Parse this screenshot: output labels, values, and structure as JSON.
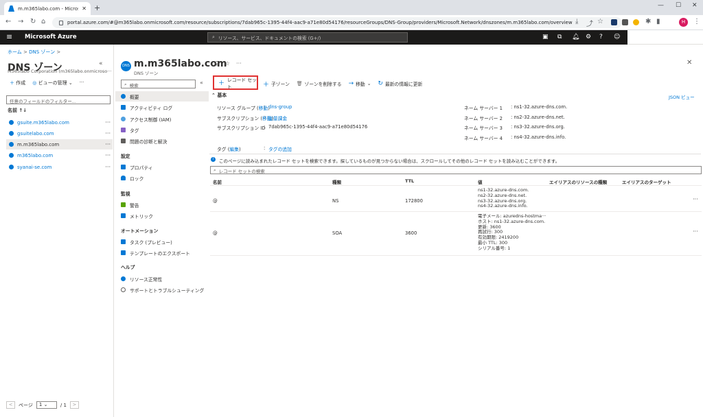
{
  "browser": {
    "tab_title": "m.m365labo.com - Microsoft Az",
    "url": "portal.azure.com/#@m365labo.onmicrosoft.com/resource/subscriptions/7dab965c-1395-44f4-aac9-a71e80d54176/resourceGroups/DNS-Group/providers/Microsoft.Network/dnszones/m.m365labo.com/overview",
    "profile_initial": "H"
  },
  "azure": {
    "brand": "Microsoft Azure",
    "search_placeholder": "リソース、サービス、ドキュメントの検索 (G+/)"
  },
  "breadcrumb": {
    "home": "ホーム",
    "sep1": ">",
    "zones": "DNS ゾーン",
    "sep2": ">"
  },
  "left_blade": {
    "title": "DNS ゾーン",
    "subtitle": "M365labo Corporation (m365labo.onmicroso···",
    "create": "作成",
    "manage_view": "ビューの管理",
    "filter_placeholder": "任意のフィールドのフィルター...",
    "name_header": "名前 ↑↓",
    "zones": [
      "gsuite.m365labo.com",
      "gsuitelabo.com",
      "m.m365labo.com",
      "m365labo.com",
      "syanai-se.com"
    ],
    "pager_label": "ページ",
    "pager_value": "1",
    "pager_total": "/ 1"
  },
  "resource": {
    "icon_label": "DNS",
    "title": "m.m365labo.com",
    "subtitle": "DNS ゾーン"
  },
  "menu": {
    "search_placeholder": "検索",
    "items": {
      "overview": "概要",
      "activity_log": "アクティビティ ログ",
      "iam": "アクセス制御 (IAM)",
      "tags": "タグ",
      "diagnose": "問題の診断と解決"
    },
    "section_settings": "設定",
    "properties": "プロパティ",
    "locks": "ロック",
    "section_monitoring": "監視",
    "alerts": "警告",
    "metrics": "メトリック",
    "section_automation": "オートメーション",
    "tasks": "タスク (プレビュー)",
    "export_template": "テンプレートのエクスポート",
    "section_help": "ヘルプ",
    "resource_health": "リソース正常性",
    "support": "サポートとトラブルシューティング"
  },
  "commands": {
    "record_set": "レコード セット",
    "child_zone": "子ゾーン",
    "delete_zone": "ゾーンを削除する",
    "move": "移動",
    "refresh": "最新の情報に更新"
  },
  "essentials": {
    "header": "基本",
    "json_view": "JSON ビュー",
    "rg_label": "リソース グループ (",
    "move_link": "移動",
    "rg_label_end": ")",
    "rg_colon": ":",
    "rg_value": "dns-group",
    "sub_label": "サブスクリプション (",
    "sub_colon": ":",
    "sub_value": "従量課金",
    "subid_label": "サブスクリプション ID",
    "subid_colon": ":",
    "subid_value": "7dab965c-1395-44f4-aac9-a71e80d54176",
    "tags_label": "タグ (",
    "tags_edit": "編集",
    "tags_colon": ":",
    "tags_add": "タグの追加",
    "ns": [
      {
        "label": "ネーム サーバー 1",
        "value": ": ns1-32.azure-dns.com."
      },
      {
        "label": "ネーム サーバー 2",
        "value": ": ns2-32.azure-dns.net."
      },
      {
        "label": "ネーム サーバー 3",
        "value": ": ns3-32.azure-dns.org."
      },
      {
        "label": "ネーム サーバー 4",
        "value": ": ns4-32.azure-dns.info."
      }
    ]
  },
  "info_text": "このページに読み込まれたレコード セットを検索できます。探しているものが見つからない場合は、スクロールしてその他のレコード セットを読み込むことができます。",
  "record_search_placeholder": "レコード セットの検索",
  "table": {
    "headers": [
      "名前",
      "種類",
      "TTL",
      "値",
      "エイリアスのリソースの種類",
      "エイリアスのターゲット"
    ],
    "rows": [
      {
        "name": "@",
        "type": "NS",
        "ttl": "172800",
        "values": [
          "ns1-32.azure-dns.com.",
          "ns2-32.azure-dns.net.",
          "ns3-32.azure-dns.org.",
          "ns4-32.azure-dns.info."
        ]
      },
      {
        "name": "@",
        "type": "SOA",
        "ttl": "3600",
        "values": [
          "電子メール: azuredns-hostma···",
          "ホスト: ns1-32.azure-dns.com.",
          "更新: 3600",
          "再試行: 300",
          "有効期限: 2419200",
          "最小 TTL: 300",
          "シリアル番号: 1"
        ]
      }
    ]
  }
}
